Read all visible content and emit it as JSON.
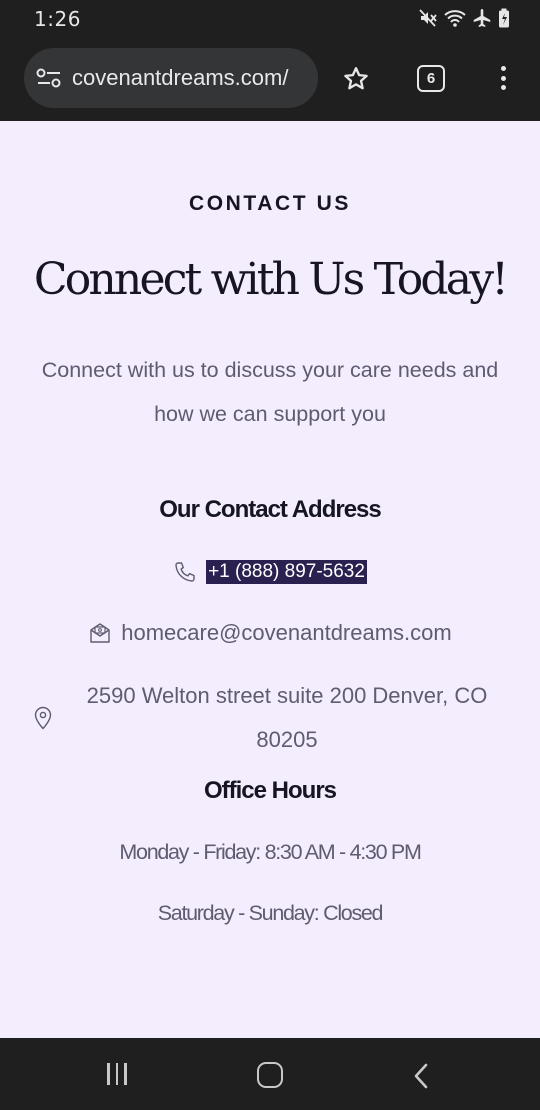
{
  "status_bar": {
    "time": "1:26",
    "icons": [
      "mute-icon",
      "wifi-icon",
      "airplane-icon",
      "battery-icon"
    ]
  },
  "browser": {
    "url": "covenantdreams.com/",
    "tab_count": "6",
    "icons": [
      "site-settings-icon",
      "bookmark-star-icon",
      "tab-switcher-icon",
      "overflow-menu-icon"
    ]
  },
  "page": {
    "eyebrow": "CONTACT US",
    "headline": "Connect with Us Today!",
    "lede": "Connect with us to discuss your care needs and how we can support you",
    "contact_heading": "Our Contact Address",
    "phone": "+1 (888) 897-5632",
    "email": "homecare@covenantdreams.com",
    "address": "2590 Welton street suite 200 Denver, CO 80205",
    "hours_heading": "Office Hours",
    "hours_weekday": "Monday - Friday: 8:30 AM - 4:30 PM",
    "hours_weekend": "Saturday - Sunday: Closed"
  },
  "colors": {
    "page_background": "#f3edfd",
    "heading_text": "#161521",
    "body_text": "#5f5b70",
    "phone_highlight": "#2a2150",
    "chrome": "#1f1f1f"
  },
  "nav_bar": {
    "icons": [
      "recent-apps-icon",
      "home-icon",
      "back-icon"
    ]
  }
}
